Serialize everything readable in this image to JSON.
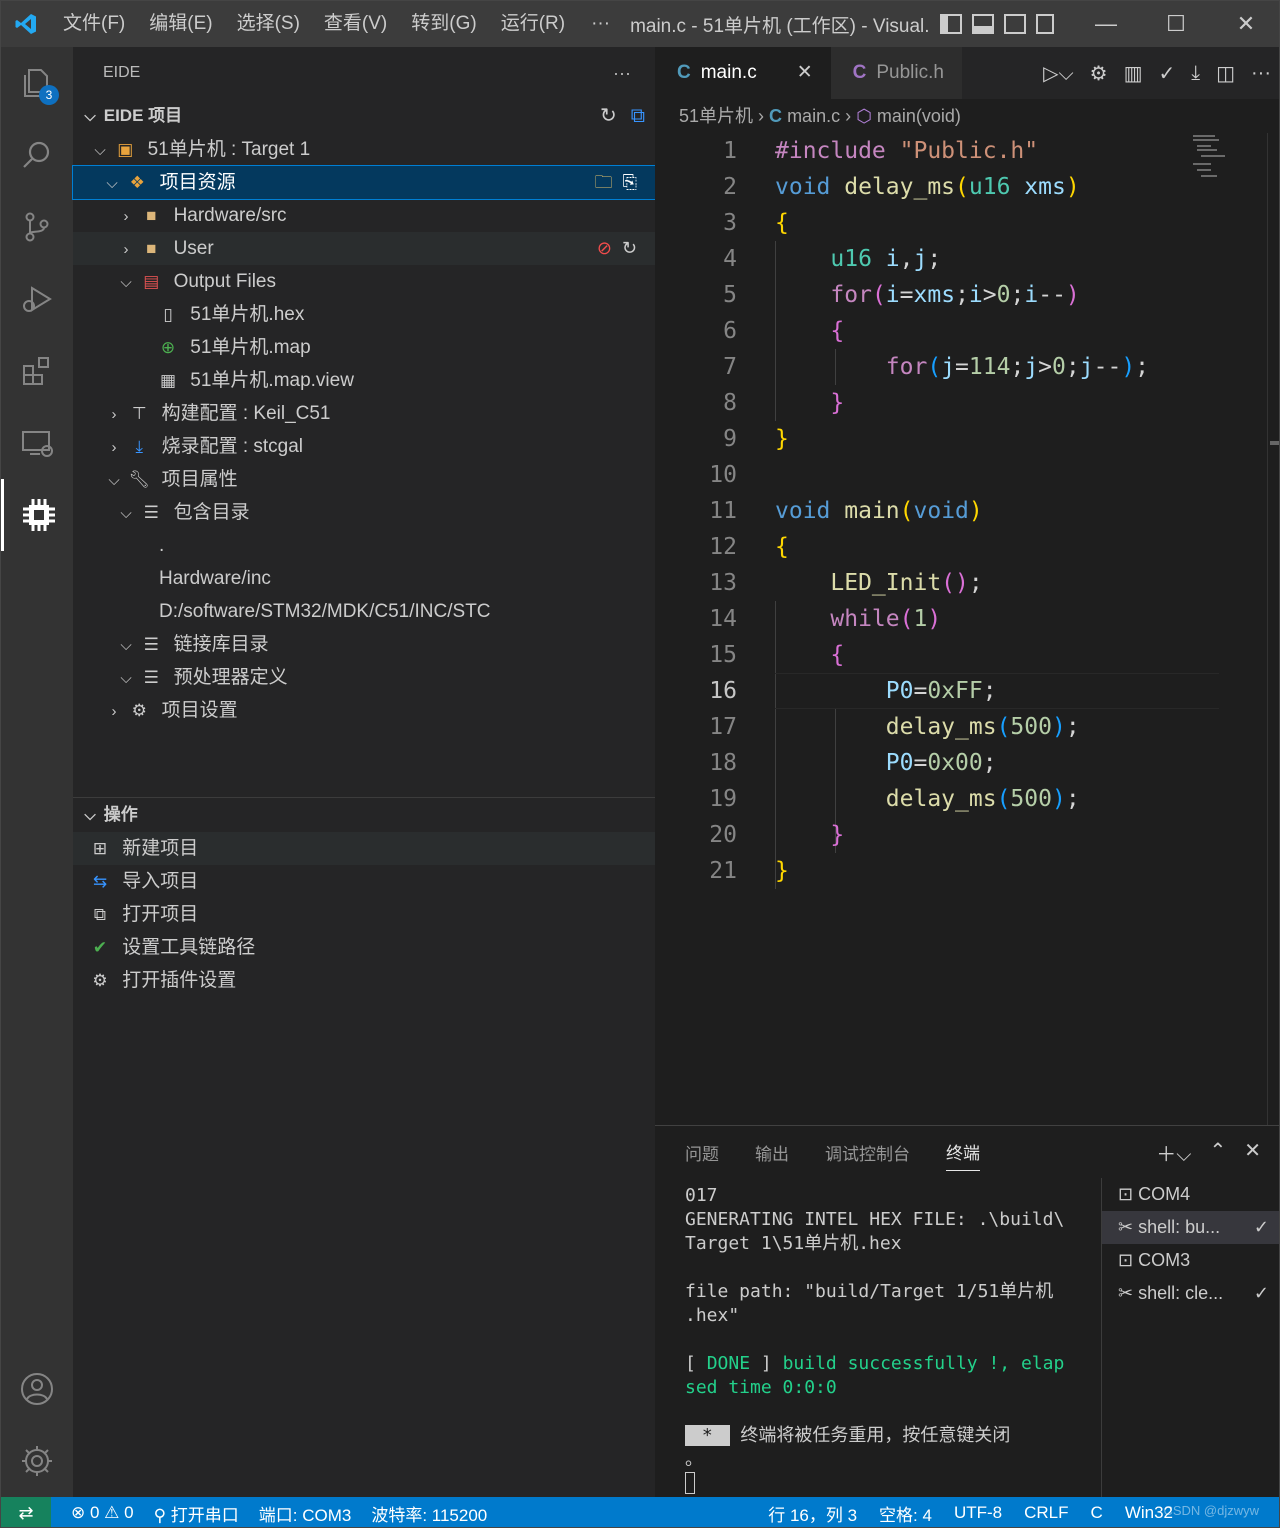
{
  "titlebar": {
    "menus": [
      "文件(F)",
      "编辑(E)",
      "选择(S)",
      "查看(V)",
      "转到(G)",
      "运行(R)"
    ],
    "more": "···",
    "title": "main.c - 51单片机 (工作区) - Visual...",
    "minimize": "—",
    "maximize": "☐",
    "close": "✕"
  },
  "activity": {
    "explorer_badge": "3"
  },
  "sidebar": {
    "header": "EIDE",
    "header_more": "···",
    "project_section": "EIDE 项目",
    "tree": {
      "project": "51单片机 : Target 1",
      "resources": "项目资源",
      "hardware_src": "Hardware/src",
      "user": "User",
      "output_files": "Output Files",
      "hex": "51单片机.hex",
      "map": "51单片机.map",
      "mapview": "51单片机.map.view",
      "build_config": "构建配置 : Keil_C51",
      "flash_config": "烧录配置 : stcgal",
      "props": "项目属性",
      "include_dirs": "包含目录",
      "inc_dot": ".",
      "inc_hw": "Hardware/inc",
      "inc_stc": "D:/software/STM32/MDK/C51/INC/STC",
      "lib_dirs": "链接库目录",
      "defines": "预处理器定义",
      "settings": "项目设置"
    },
    "ops_section": "操作",
    "ops": [
      "新建项目",
      "导入项目",
      "打开项目",
      "设置工具链路径",
      "打开插件设置"
    ]
  },
  "editor": {
    "tab_active": "main.c",
    "tab_inactive": "Public.h",
    "tab_icon": "C",
    "breadcrumb_folder": "51单片机",
    "breadcrumb_file": "main.c",
    "breadcrumb_symbol": "main(void)",
    "current_line": 16
  },
  "panel": {
    "tabs": [
      "问题",
      "输出",
      "调试控制台",
      "终端"
    ],
    "active_tab": "终端",
    "terminal": {
      "l1": "017",
      "l2": "GENERATING INTEL HEX FILE: .\\build\\",
      "l3": "Target 1\\51单片机.hex",
      "l4": "file path: \"build/Target 1/51单片机",
      "l5": ".hex\"",
      "l6a": "[ ",
      "l6b": "DONE",
      "l6c": " ] ",
      "l6d": "build successfully !, elap",
      "l7": "sed time 0:0:0",
      "l8a": " * ",
      "l8b": " 终端将被任务重用，按任意键关闭",
      "l9": "。"
    },
    "terminals": [
      "COM4",
      "shell: bu...",
      "COM3",
      "shell: cle..."
    ]
  },
  "status": {
    "errors": "0",
    "warnings": "0",
    "serial": "打开串口",
    "port": "端口: COM3",
    "baud": "波特率: 115200",
    "position": "行 16，列 3",
    "spaces": "空格: 4",
    "encoding": "UTF-8",
    "eol": "CRLF",
    "lang": "C",
    "platform": "Win32",
    "watermark": "CSDN @djzwyw"
  }
}
